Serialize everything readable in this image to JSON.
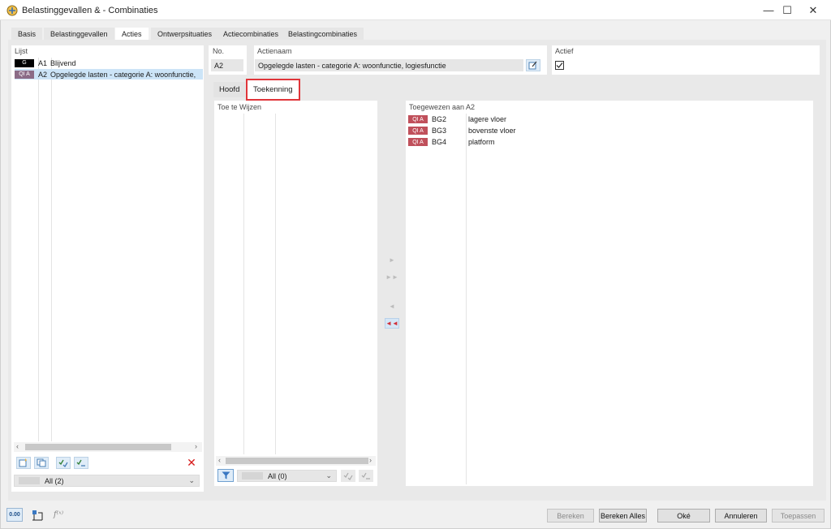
{
  "window": {
    "title": "Belastinggevallen & - Combinaties",
    "minimize": "—",
    "maximize": "☐",
    "close": "✕"
  },
  "tabs": [
    {
      "label": "Basis",
      "active": false
    },
    {
      "label": "Belastinggevallen",
      "active": false
    },
    {
      "label": "Acties",
      "active": true
    },
    {
      "label": "Ontwerpsituaties",
      "active": false
    },
    {
      "label": "Actiecombinaties",
      "active": false
    },
    {
      "label": "Belastingcombinaties",
      "active": false
    }
  ],
  "list": {
    "title": "Lijst",
    "items": [
      {
        "tag": "G",
        "id": "A1",
        "name": "Blijvend",
        "selected": false
      },
      {
        "tag": "QI A",
        "id": "A2",
        "name": "Opgelegde lasten - categorie A: woonfunctie,",
        "selected": true
      }
    ],
    "filter_value": "All (2)"
  },
  "fields": {
    "no_label": "No.",
    "no_value": "A2",
    "name_label": "Actienaam",
    "name_value": "Opgelegde lasten - categorie A: woonfunctie, logiesfunctie",
    "active_label": "Actief",
    "active_checked": true
  },
  "inner_tabs": [
    {
      "label": "Hoofd",
      "active": false
    },
    {
      "label": "Toekenning",
      "active": true
    }
  ],
  "to_assign": {
    "title": "Toe te Wijzen",
    "filter_value": "All (0)"
  },
  "assigned": {
    "title": "Toegewezen aan A2",
    "items": [
      {
        "tag": "QI A",
        "id": "BG2",
        "name": "lagere vloer"
      },
      {
        "tag": "QI A",
        "id": "BG3",
        "name": "bovenste vloer"
      },
      {
        "tag": "QI A",
        "id": "BG4",
        "name": "platform"
      }
    ]
  },
  "transfer": {
    "add_one": "►",
    "add_all": "►►",
    "remove_one": "◄",
    "remove_all": "◄◄"
  },
  "footer": {
    "units_label": "0.00",
    "buttons": {
      "bereken": "Bereken",
      "bereken_alles": "Bereken Alles",
      "oke": "Oké",
      "annuleren": "Annuleren",
      "toepassen": "Toepassen"
    }
  },
  "colors": {
    "accent": "#cce4f7",
    "highlight_border": "#e0353a",
    "tag_g": "#000000",
    "tag_qia": "#c0505b"
  }
}
